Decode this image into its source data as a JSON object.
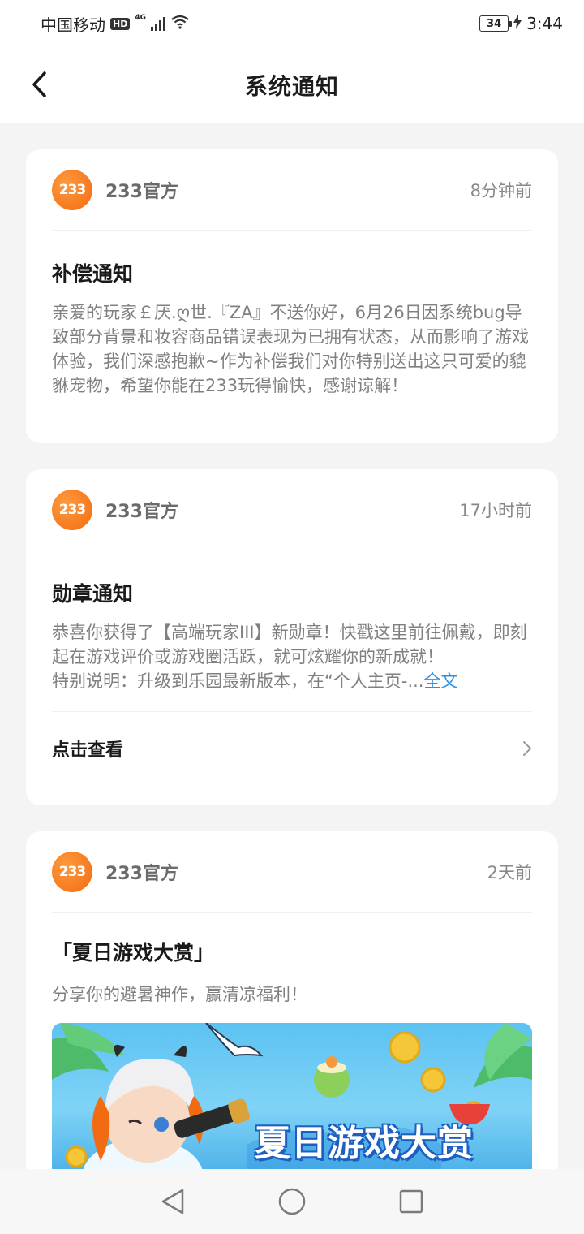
{
  "status_bar": {
    "carrier": "中国移动",
    "hd": "HD",
    "network": "4G",
    "battery": "34",
    "time": "3:44"
  },
  "header": {
    "title": "系统通知",
    "back_icon": "chevron-left-icon"
  },
  "notifications": [
    {
      "sender": "233官方",
      "avatar_text": "233",
      "time": "8分钟前",
      "title": "补偿通知",
      "body": "亲爱的玩家￡厌.ღ世.『ZA』不送你好，6月26日因系统bug导致部分背景和妆容商品错误表现为已拥有状态，从而影响了游戏体验，我们深感抱歉~作为补偿我们对你特别送出这只可爱的貔貅宠物，希望你能在233玩得愉快，感谢谅解！"
    },
    {
      "sender": "233官方",
      "avatar_text": "233",
      "time": "17小时前",
      "title": "勋章通知",
      "body": "恭喜你获得了【高端玩家III】新勋章！快戳这里前往佩戴，即刻起在游戏评价或游戏圈活跃，就可炫耀你的新成就！",
      "body_extra": "特别说明：升级到乐园最新版本，在“个人主页-...",
      "full_text_link": "全文",
      "footer_label": "点击查看"
    },
    {
      "sender": "233官方",
      "avatar_text": "233",
      "time": "2天前",
      "title": "「夏日游戏大赏」",
      "body": "分享你的避暑神作，赢清凉福利！",
      "banner_text": "夏日游戏大赏"
    }
  ],
  "nav_bar": {
    "back": "triangle-back-icon",
    "home": "circle-home-icon",
    "recents": "square-recents-icon"
  }
}
